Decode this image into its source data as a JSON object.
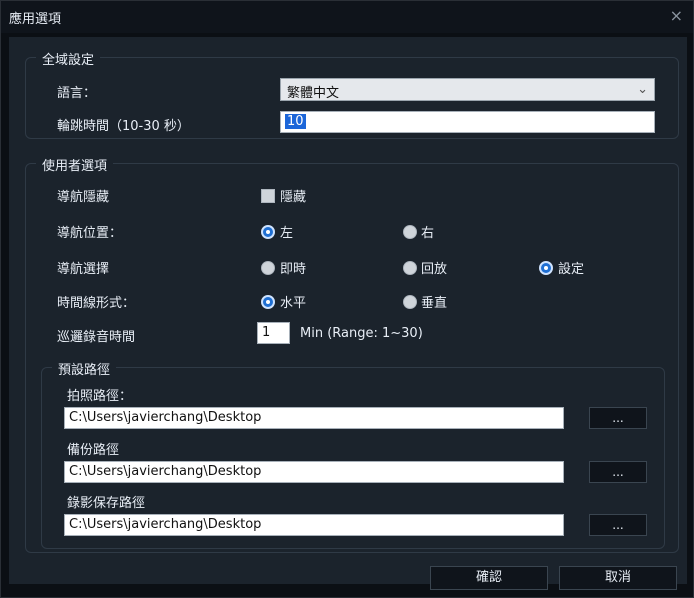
{
  "window": {
    "title": "應用選項",
    "close_glyph": "×"
  },
  "global": {
    "title": "全域設定",
    "language_label": "語言：",
    "language_value": "繁體中文",
    "rotation_label": "輪跳時間（10-30 秒）",
    "rotation_value": "10"
  },
  "user": {
    "title": "使用者選項",
    "nav_hide_label": "導航隱藏",
    "nav_hide_checkbox_label": "隱藏",
    "nav_pos_label": "導航位置：",
    "nav_pos_left": "左",
    "nav_pos_right": "右",
    "nav_sel_label": "導航選擇",
    "nav_sel_realtime": "即時",
    "nav_sel_playback": "回放",
    "nav_sel_settings": "設定",
    "timeline_label": "時間線形式：",
    "timeline_horizontal": "水平",
    "timeline_vertical": "垂直",
    "patrol_label": "巡邏錄音時間",
    "patrol_value": "1",
    "patrol_hint": "Min (Range: 1~30)"
  },
  "paths": {
    "title": "預設路徑",
    "photo_label": "拍照路徑：",
    "photo_value": "C:\\Users\\javierchang\\Desktop",
    "backup_label": "備份路徑",
    "backup_value": "C:\\Users\\javierchang\\Desktop",
    "record_label": "錄影保存路徑",
    "record_value": "C:\\Users\\javierchang\\Desktop",
    "browse_label": "..."
  },
  "buttons": {
    "ok": "確認",
    "cancel": "取消"
  },
  "colors": {
    "window_bg": "#0b0f14",
    "panel_bg": "#1b232c",
    "accent_blue": "#1f6fd3"
  }
}
